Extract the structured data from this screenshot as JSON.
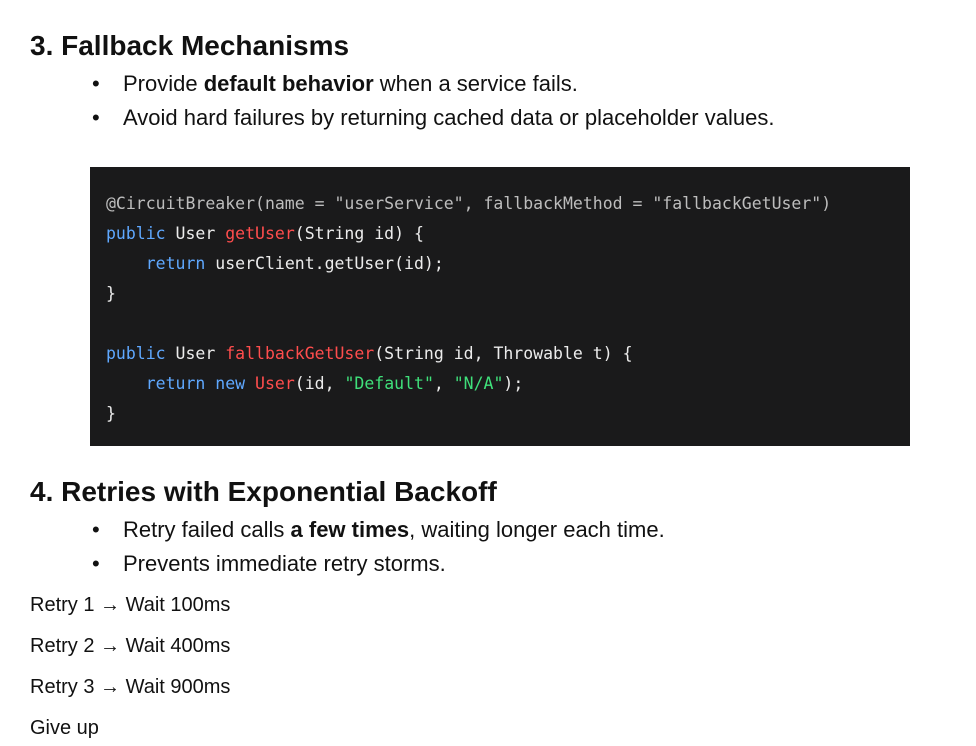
{
  "section3": {
    "title": "3. Fallback Mechanisms",
    "bullets": [
      {
        "pre": "Provide ",
        "bold": "default behavior",
        "post": " when a service fails."
      },
      {
        "pre": "Avoid hard failures by returning cached data or placeholder values.",
        "bold": "",
        "post": ""
      }
    ]
  },
  "code": {
    "lines": [
      [
        {
          "t": "@CircuitBreaker(name = \"userService\", fallbackMethod = \"fallbackGetUser\")",
          "c": "ann"
        }
      ],
      [
        {
          "t": "public",
          "c": "kw"
        },
        {
          "t": " User ",
          "c": "plain"
        },
        {
          "t": "getUser",
          "c": "fn"
        },
        {
          "t": "(String id) {",
          "c": "plain"
        }
      ],
      [
        {
          "t": "    ",
          "c": "plain"
        },
        {
          "t": "return",
          "c": "kw"
        },
        {
          "t": " userClient.getUser(id);",
          "c": "plain"
        }
      ],
      [
        {
          "t": "}",
          "c": "plain"
        }
      ],
      [
        {
          "t": "",
          "c": "plain"
        }
      ],
      [
        {
          "t": "public",
          "c": "kw"
        },
        {
          "t": " User ",
          "c": "plain"
        },
        {
          "t": "fallbackGetUser",
          "c": "fn"
        },
        {
          "t": "(String id, Throwable t) {",
          "c": "plain"
        }
      ],
      [
        {
          "t": "    ",
          "c": "plain"
        },
        {
          "t": "return",
          "c": "kw"
        },
        {
          "t": " ",
          "c": "plain"
        },
        {
          "t": "new",
          "c": "kw"
        },
        {
          "t": " ",
          "c": "plain"
        },
        {
          "t": "User",
          "c": "fn"
        },
        {
          "t": "(id, ",
          "c": "plain"
        },
        {
          "t": "\"Default\"",
          "c": "str"
        },
        {
          "t": ", ",
          "c": "plain"
        },
        {
          "t": "\"N/A\"",
          "c": "str"
        },
        {
          "t": ");",
          "c": "plain"
        }
      ],
      [
        {
          "t": "}",
          "c": "plain"
        }
      ]
    ]
  },
  "section4": {
    "title": "4. Retries with Exponential Backoff",
    "bullets": [
      {
        "pre": "Retry failed calls ",
        "bold": "a few times",
        "post": ", waiting longer each time."
      },
      {
        "pre": "Prevents immediate retry storms.",
        "bold": "",
        "post": ""
      }
    ]
  },
  "retries": [
    "Retry 1 → Wait 100ms",
    "Retry 2 → Wait 400ms",
    "Retry 3 → Wait 900ms",
    "Give up"
  ]
}
